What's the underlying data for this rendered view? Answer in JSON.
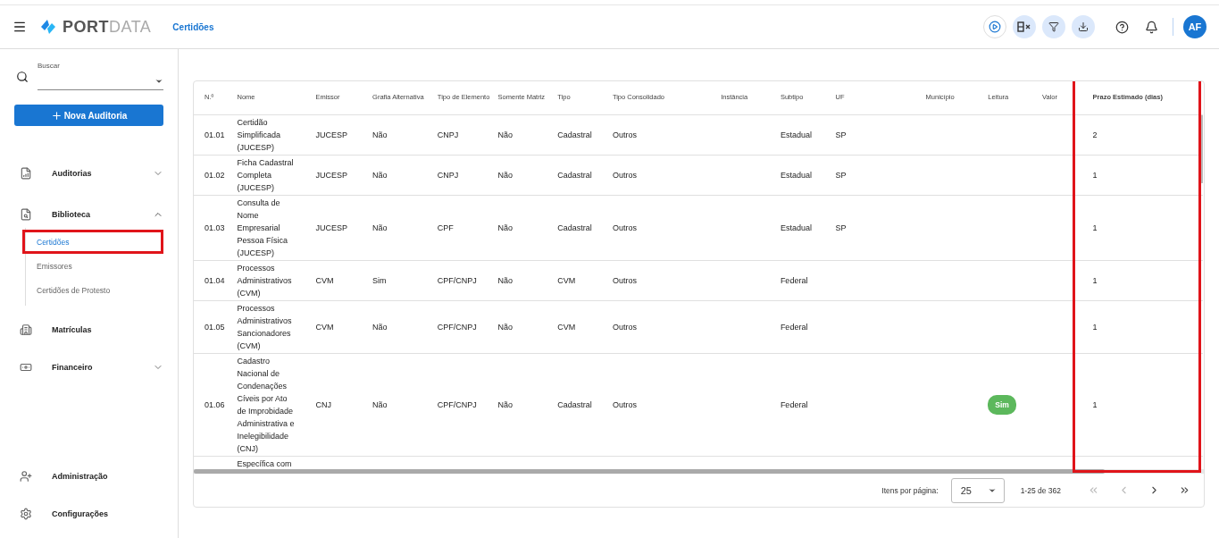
{
  "header": {
    "brand_strong": "PORT",
    "brand_light": "DATA",
    "page_title": "Certidões",
    "avatar": "AF"
  },
  "sidebar": {
    "search": {
      "label": "Buscar"
    },
    "new_button": "Nova Auditoria",
    "items": [
      {
        "label": "Auditorias",
        "expanded": false
      },
      {
        "label": "Biblioteca",
        "expanded": true,
        "children": [
          {
            "label": "Certidões",
            "selected": true,
            "highlighted": true
          },
          {
            "label": "Emissores",
            "selected": false,
            "highlighted": false
          },
          {
            "label": "Certidões de Protesto",
            "selected": false,
            "highlighted": false
          }
        ]
      },
      {
        "label": "Matrículas"
      },
      {
        "label": "Financeiro",
        "expanded": false
      }
    ],
    "bottom_items": [
      {
        "label": "Administração"
      },
      {
        "label": "Configurações"
      }
    ]
  },
  "table": {
    "columns": [
      {
        "label": "N.º",
        "kind": "text",
        "highlighted": false
      },
      {
        "label": "Nome",
        "kind": "text",
        "highlighted": false
      },
      {
        "label": "Emissor",
        "kind": "text",
        "highlighted": false
      },
      {
        "label": "Grafia Alternativa",
        "kind": "text",
        "highlighted": false
      },
      {
        "label": "Tipo de Elemento",
        "kind": "text",
        "highlighted": false
      },
      {
        "label": "Somente Matriz",
        "kind": "text",
        "highlighted": false
      },
      {
        "label": "Tipo",
        "kind": "text",
        "highlighted": false
      },
      {
        "label": "Tipo Consolidado",
        "kind": "text",
        "highlighted": false
      },
      {
        "label": "Instância",
        "kind": "text",
        "highlighted": false
      },
      {
        "label": "Subtipo",
        "kind": "text",
        "highlighted": false
      },
      {
        "label": "UF",
        "kind": "text",
        "highlighted": false
      },
      {
        "label": "Município",
        "kind": "text",
        "highlighted": false
      },
      {
        "label": "Leitura",
        "kind": "badge",
        "highlighted": false
      },
      {
        "label": "Valor",
        "kind": "text",
        "highlighted": false
      },
      {
        "label": "Prazo Estimado (dias)",
        "kind": "text",
        "highlighted": true
      }
    ],
    "rows": [
      {
        "cells": [
          "01.01",
          "Certidão Simplificada (JUCESP)",
          "JUCESP",
          "Não",
          "CNPJ",
          "Não",
          "Cadastral",
          "Outros",
          null,
          "Estadual",
          "SP",
          null,
          null,
          null,
          "2"
        ]
      },
      {
        "cells": [
          "01.02",
          "Ficha Cadastral Completa (JUCESP)",
          "JUCESP",
          "Não",
          "CNPJ",
          "Não",
          "Cadastral",
          "Outros",
          null,
          "Estadual",
          "SP",
          null,
          null,
          null,
          "1"
        ]
      },
      {
        "cells": [
          "01.03",
          "Consulta de Nome Empresarial Pessoa Física (JUCESP)",
          "JUCESP",
          "Não",
          "CPF",
          "Não",
          "Cadastral",
          "Outros",
          null,
          "Estadual",
          "SP",
          null,
          null,
          null,
          "1"
        ]
      },
      {
        "cells": [
          "01.04",
          "Processos Administrativos (CVM)",
          "CVM",
          "Sim",
          "CPF/CNPJ",
          "Não",
          "CVM",
          "Outros",
          null,
          "Federal",
          null,
          null,
          null,
          null,
          "1"
        ]
      },
      {
        "cells": [
          "01.05",
          "Processos Administrativos Sancionadores (CVM)",
          "CVM",
          "Não",
          "CPF/CNPJ",
          "Não",
          "CVM",
          "Outros",
          null,
          "Federal",
          null,
          null,
          null,
          null,
          "1"
        ]
      },
      {
        "cells": [
          "01.06",
          "Cadastro Nacional de Condenações Cíveis por Ato de Improbidade Administrativa e Inelegibilidade (CNJ)",
          "CNJ",
          "Não",
          "CPF/CNPJ",
          "Não",
          "Cadastral",
          "Outros",
          null,
          "Federal",
          null,
          null,
          "Sim",
          null,
          "1"
        ]
      },
      {
        "cells": [
          null,
          "Específica com",
          null,
          null,
          null,
          null,
          null,
          null,
          null,
          null,
          null,
          null,
          null,
          null,
          null
        ]
      }
    ]
  },
  "pagination": {
    "label": "Itens por página:",
    "page_size": "25",
    "range": "1-25 de 362"
  }
}
